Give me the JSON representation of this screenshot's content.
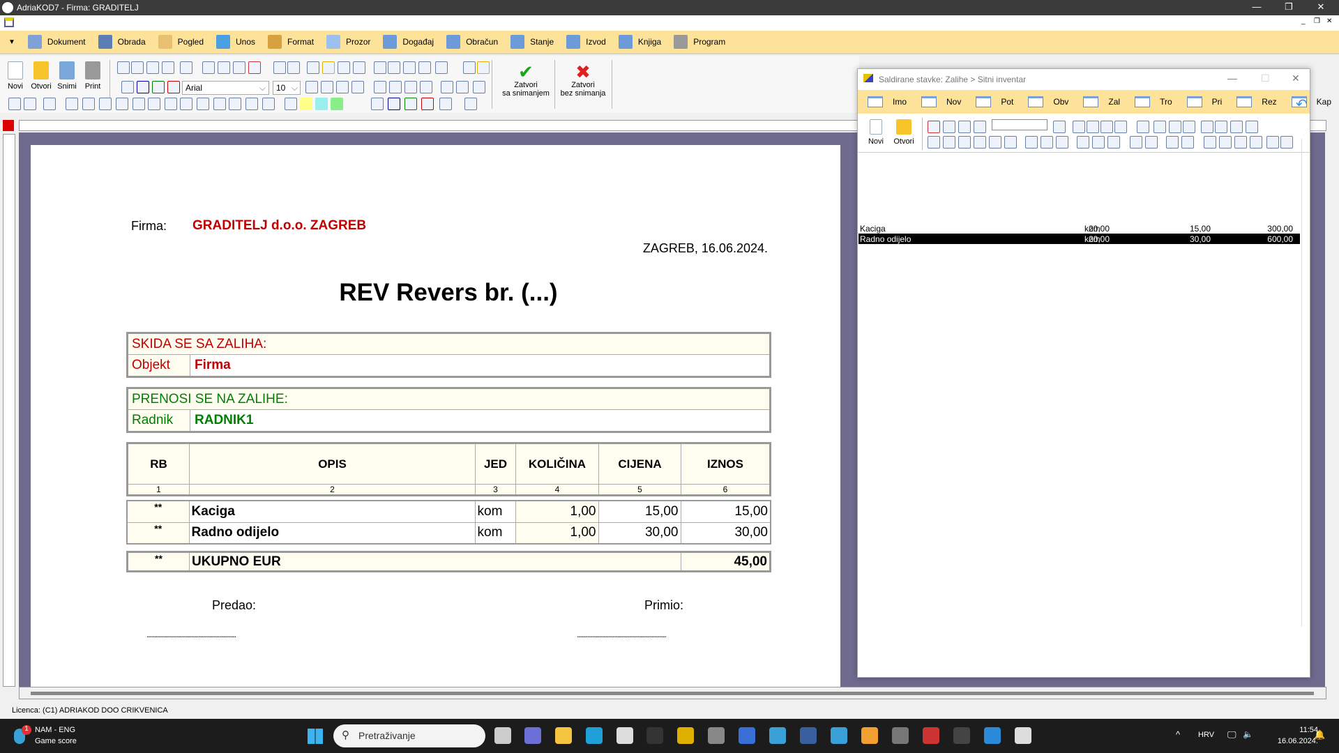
{
  "window": {
    "title": "AdriaKOD7 - Firma: GRADITELJ",
    "minimize": "—",
    "restore": "❐",
    "close": "✕"
  },
  "menu": [
    {
      "label": "Dokument",
      "icon": "document-icon"
    },
    {
      "label": "Obrada",
      "icon": "tools-icon"
    },
    {
      "label": "Pogled",
      "icon": "preview-icon"
    },
    {
      "label": "Unos",
      "icon": "input-arrow-icon"
    },
    {
      "label": "Format",
      "icon": "brush-icon"
    },
    {
      "label": "Prozor",
      "icon": "window-icon"
    },
    {
      "label": "Događaj",
      "icon": "grid-icon"
    },
    {
      "label": "Obračun",
      "icon": "grid-icon"
    },
    {
      "label": "Stanje",
      "icon": "grid-icon"
    },
    {
      "label": "Izvod",
      "icon": "grid-icon"
    },
    {
      "label": "Knjiga",
      "icon": "grid-icon"
    },
    {
      "label": "Program",
      "icon": "gear-icon"
    }
  ],
  "toolbar": {
    "novi": "Novi",
    "otvori": "Otvori",
    "snimi": "Snimi",
    "print": "Print",
    "font": "Arial",
    "size": "10",
    "save_close_1": "Zatvori",
    "save_close_2": "sa snimanjem",
    "close_nosave_1": "Zatvori",
    "close_nosave_2": "bez snimanja",
    "colors": {
      "save": "#1aa51a",
      "cancel": "#e02020"
    }
  },
  "document": {
    "firma_label": "Firma:",
    "firma": "GRADITELJ d.o.o. ZAGREB",
    "date": "ZAGREB, 16.06.2024.",
    "title": "REV Revers br. (...)",
    "from": {
      "heading": "SKIDA SE SA ZALIHA:",
      "label": "Objekt",
      "value": "Firma"
    },
    "to": {
      "heading": "PRENOSI SE NA ZALIHE:",
      "label": "Radnik",
      "value": "RADNIK1"
    },
    "columns": [
      "RB",
      "OPIS",
      "JED",
      "KOLIČINA",
      "CIJENA",
      "IZNOS"
    ],
    "col_numbers": [
      "1",
      "2",
      "3",
      "4",
      "5",
      "6"
    ],
    "rows": [
      {
        "rb": "**",
        "opis": "Kaciga",
        "jed": "kom",
        "kolicina": "1,00",
        "cijena": "15,00",
        "iznos": "15,00"
      },
      {
        "rb": "**",
        "opis": "Radno odijelo",
        "jed": "kom",
        "kolicina": "1,00",
        "cijena": "30,00",
        "iznos": "30,00"
      }
    ],
    "total": {
      "rb": "**",
      "label": "UKUPNO EUR",
      "value": "45,00"
    },
    "predao": "Predao:",
    "primio": "Primio:",
    "sign_line": "............................................................"
  },
  "child": {
    "title": "Saldirane stavke:  Zalihe > Sitni inventar",
    "tabs": [
      "Imo",
      "Nov",
      "Pot",
      "Obv",
      "Zal",
      "Tro",
      "Pri",
      "Rez",
      "Kap"
    ],
    "novi": "Novi",
    "otvori": "Otvori",
    "search_value": "",
    "rows": [
      {
        "name": "Kaciga",
        "unit": "kom",
        "qty": "20,00",
        "price": "15,00",
        "amount": "300,00",
        "selected": false
      },
      {
        "name": "Radno odijelo",
        "unit": "kom",
        "qty": "20,00",
        "price": "30,00",
        "amount": "600,00",
        "selected": true
      }
    ]
  },
  "status": {
    "licence": "Licenca:  (C1) ADRIAKOD DOO CRIKVENICA"
  },
  "taskbar": {
    "weather_badge": "1",
    "weather_1": "NAM - ENG",
    "weather_2": "Game score",
    "search": "Pretraživanje",
    "lang": "HRV",
    "time": "11:54",
    "date": "16.06.2024."
  }
}
